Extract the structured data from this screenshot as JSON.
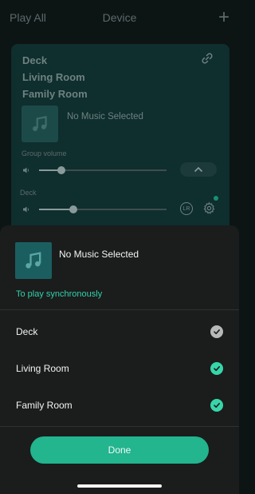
{
  "topbar": {
    "left_label": "Play All",
    "title": "Device",
    "add_icon": "plus-icon"
  },
  "group_card": {
    "rooms": [
      "Deck",
      "Living Room",
      "Family Room"
    ],
    "link_icon": "link-icon",
    "now_playing": "No Music Selected",
    "group_volume_label": "Group volume",
    "group_volume_level": 0.17,
    "expand_icon": "chevron-up-icon",
    "speaker_label": "Deck",
    "speaker_volume_level": 0.26,
    "lr_badge": "LR",
    "settings_icon": "gear-icon",
    "status_color": "#1a8f72"
  },
  "sheet": {
    "now_playing": "No Music Selected",
    "art_icon": "music-note-icon",
    "subtitle": "To play synchronously",
    "rooms": [
      {
        "name": "Deck",
        "checked": true,
        "state": "locked"
      },
      {
        "name": "Living Room",
        "checked": true,
        "state": "selected"
      },
      {
        "name": "Family Room",
        "checked": true,
        "state": "selected"
      }
    ],
    "done_label": "Done",
    "accent_color": "#22b58e"
  }
}
